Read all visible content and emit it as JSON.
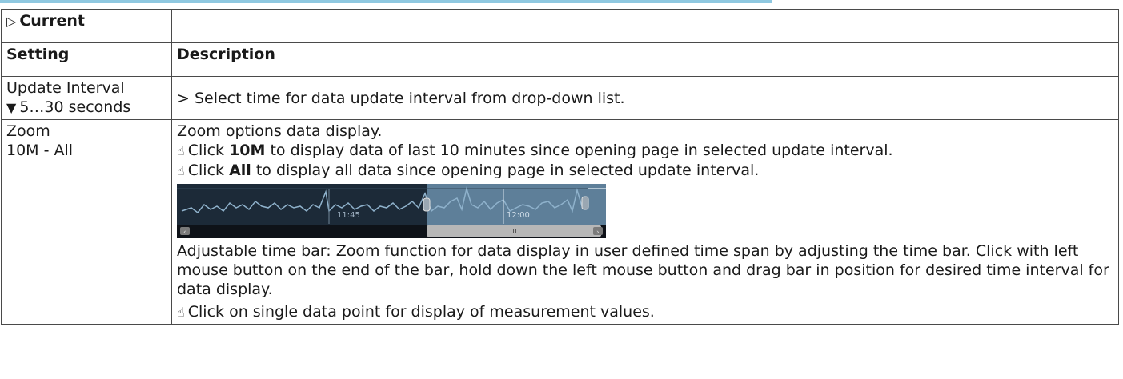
{
  "header": {
    "current_label": "Current",
    "current_icon": "triangle-right-outline-icon"
  },
  "columns": {
    "setting": "Setting",
    "description": "Description"
  },
  "rows": {
    "update_interval": {
      "name": "Update Interval",
      "value": "5…30 seconds",
      "value_icon": "triangle-down-filled-icon",
      "description": "> Select time for data update interval from drop-down list."
    },
    "zoom": {
      "name": "Zoom",
      "value": "10M - All",
      "intro": "Zoom options data display.",
      "click_word": "Click",
      "opt_10m": "10M",
      "opt_10m_text": "to display data of last 10 minutes since opening page in selected update interval.",
      "opt_all": "All",
      "opt_all_text": "to display all data since opening page in selected update interval.",
      "timebar": {
        "label_left": "11:45",
        "label_right": "12:00",
        "colors": {
          "dark": "#1c2a38",
          "blue": "#5e7f99",
          "line": "#8fb2cc",
          "thumb": "#b7b7b7"
        }
      },
      "adjustable_text": "Adjustable time bar: Zoom function for data display in user defined time span by adjusting the time bar. Click with left mouse button on the end of the bar, hold down the left mouse button and drag bar in position for desired time interval for data display.",
      "single_point_text": "Click on single data point for display of measurement values."
    }
  },
  "icons": {
    "hand": "pointing-hand-icon"
  }
}
